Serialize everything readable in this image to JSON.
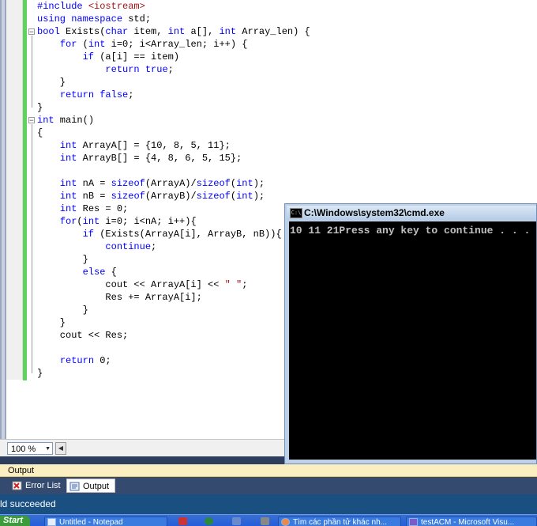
{
  "editor": {
    "code_lines": [
      [
        {
          "t": "#include ",
          "c": "pp"
        },
        {
          "t": "<iostream>",
          "c": "str"
        }
      ],
      [
        {
          "t": "using",
          "c": "kw"
        },
        {
          "t": " "
        },
        {
          "t": "namespace",
          "c": "kw"
        },
        {
          "t": " std;"
        }
      ],
      [
        {
          "t": "bool",
          "c": "kw"
        },
        {
          "t": " Exists("
        },
        {
          "t": "char",
          "c": "kw"
        },
        {
          "t": " item, "
        },
        {
          "t": "int",
          "c": "kw"
        },
        {
          "t": " a[], "
        },
        {
          "t": "int",
          "c": "kw"
        },
        {
          "t": " Array_len) {"
        }
      ],
      [
        {
          "t": "    "
        },
        {
          "t": "for",
          "c": "kw"
        },
        {
          "t": " ("
        },
        {
          "t": "int",
          "c": "kw"
        },
        {
          "t": " i=0; i<Array_len; i++) {"
        }
      ],
      [
        {
          "t": "        "
        },
        {
          "t": "if",
          "c": "kw"
        },
        {
          "t": " (a[i] == item)"
        }
      ],
      [
        {
          "t": "            "
        },
        {
          "t": "return",
          "c": "kw"
        },
        {
          "t": " "
        },
        {
          "t": "true",
          "c": "kw"
        },
        {
          "t": ";"
        }
      ],
      [
        {
          "t": "    }"
        }
      ],
      [
        {
          "t": "    "
        },
        {
          "t": "return",
          "c": "kw"
        },
        {
          "t": " "
        },
        {
          "t": "false",
          "c": "kw"
        },
        {
          "t": ";"
        }
      ],
      [
        {
          "t": "}"
        }
      ],
      [
        {
          "t": "int",
          "c": "kw"
        },
        {
          "t": " main()"
        }
      ],
      [
        {
          "t": "{"
        }
      ],
      [
        {
          "t": "    "
        },
        {
          "t": "int",
          "c": "kw"
        },
        {
          "t": " ArrayA[] = {10, 8, 5, 11};"
        }
      ],
      [
        {
          "t": "    "
        },
        {
          "t": "int",
          "c": "kw"
        },
        {
          "t": " ArrayB[] = {4, 8, 6, 5, 15};"
        }
      ],
      [
        {
          "t": ""
        }
      ],
      [
        {
          "t": "    "
        },
        {
          "t": "int",
          "c": "kw"
        },
        {
          "t": " nA = "
        },
        {
          "t": "sizeof",
          "c": "kw"
        },
        {
          "t": "(ArrayA)/"
        },
        {
          "t": "sizeof",
          "c": "kw"
        },
        {
          "t": "("
        },
        {
          "t": "int",
          "c": "kw"
        },
        {
          "t": ");"
        }
      ],
      [
        {
          "t": "    "
        },
        {
          "t": "int",
          "c": "kw"
        },
        {
          "t": " nB = "
        },
        {
          "t": "sizeof",
          "c": "kw"
        },
        {
          "t": "(ArrayB)/"
        },
        {
          "t": "sizeof",
          "c": "kw"
        },
        {
          "t": "("
        },
        {
          "t": "int",
          "c": "kw"
        },
        {
          "t": ");"
        }
      ],
      [
        {
          "t": "    "
        },
        {
          "t": "int",
          "c": "kw"
        },
        {
          "t": " Res = 0;"
        }
      ],
      [
        {
          "t": "    "
        },
        {
          "t": "for",
          "c": "kw"
        },
        {
          "t": "("
        },
        {
          "t": "int",
          "c": "kw"
        },
        {
          "t": " i=0; i<nA; i++){"
        }
      ],
      [
        {
          "t": "        "
        },
        {
          "t": "if",
          "c": "kw"
        },
        {
          "t": " (Exists(ArrayA[i], ArrayB, nB)){"
        }
      ],
      [
        {
          "t": "            "
        },
        {
          "t": "continue",
          "c": "kw"
        },
        {
          "t": ";"
        }
      ],
      [
        {
          "t": "        }"
        }
      ],
      [
        {
          "t": "        "
        },
        {
          "t": "else",
          "c": "kw"
        },
        {
          "t": " {"
        }
      ],
      [
        {
          "t": "            cout << ArrayA[i] << "
        },
        {
          "t": "\" \"",
          "c": "str"
        },
        {
          "t": ";"
        }
      ],
      [
        {
          "t": "            Res += ArrayA[i];"
        }
      ],
      [
        {
          "t": "        }"
        }
      ],
      [
        {
          "t": "    }"
        }
      ],
      [
        {
          "t": "    cout << Res;"
        }
      ],
      [
        {
          "t": ""
        }
      ],
      [
        {
          "t": "    "
        },
        {
          "t": "return",
          "c": "kw"
        },
        {
          "t": " 0;"
        }
      ],
      [
        {
          "t": "}"
        }
      ]
    ],
    "zoom": "100 %"
  },
  "cmd": {
    "title": "C:\\Windows\\system32\\cmd.exe",
    "icon_label": "C:\\",
    "output": "10 11 21Press any key to continue . . ."
  },
  "output_panel": {
    "title": "Output",
    "tabs": {
      "error_list": "Error List",
      "output": "Output"
    },
    "status": "ld succeeded"
  },
  "taskbar": {
    "start": "Start",
    "items": [
      {
        "label": "Untitled - Notepad"
      },
      {
        "label": "Tìm các phần tử khác nh..."
      },
      {
        "label": "testACM - Microsoft Visu..."
      }
    ]
  },
  "colors": {
    "keyword": "#0000ff",
    "string": "#a31515",
    "change_bar": "#5fd35f",
    "cmd_background": "#000000",
    "status_bar": "#1a4f82"
  }
}
